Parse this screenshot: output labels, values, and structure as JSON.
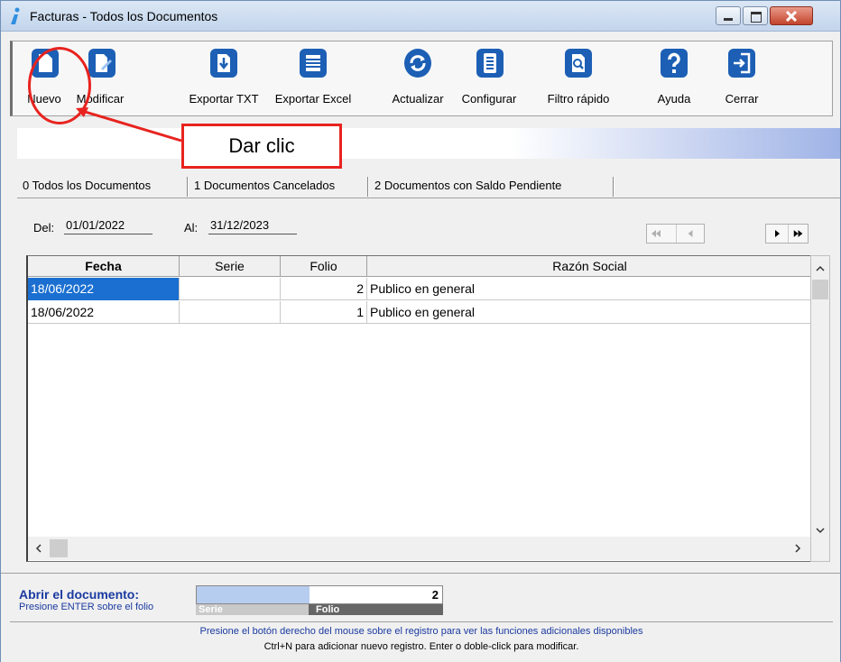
{
  "window": {
    "title": "Facturas - Todos los Documentos"
  },
  "toolbar": {
    "buttons": [
      {
        "label": "Nuevo",
        "icon": "new-document-icon"
      },
      {
        "label": "Modificar",
        "icon": "edit-document-icon"
      },
      {
        "label": "Exportar TXT",
        "icon": "export-txt-icon"
      },
      {
        "label": "Exportar Excel",
        "icon": "export-excel-icon"
      },
      {
        "label": "Actualizar",
        "icon": "refresh-icon"
      },
      {
        "label": "Configurar",
        "icon": "configure-icon"
      },
      {
        "label": "Filtro rápido",
        "icon": "quick-filter-icon"
      },
      {
        "label": "Ayuda",
        "icon": "help-icon"
      },
      {
        "label": "Cerrar",
        "icon": "close-door-icon"
      }
    ]
  },
  "callout": {
    "text": "Dar clic"
  },
  "tabs": [
    {
      "label": "0 Todos los Documentos"
    },
    {
      "label": "1 Documentos Cancelados"
    },
    {
      "label": "2 Documentos con Saldo Pendiente"
    }
  ],
  "filters": {
    "del_label": "Del:",
    "del_value": "01/01/2022",
    "al_label": "Al:",
    "al_value": "31/12/2023"
  },
  "grid": {
    "columns": [
      "Fecha",
      "Serie",
      "Folio",
      "Razón Social"
    ],
    "rows": [
      {
        "fecha": "18/06/2022",
        "serie": "",
        "folio": "2",
        "razon": "Publico en general"
      },
      {
        "fecha": "18/06/2022",
        "serie": "",
        "folio": "1",
        "razon": "Publico en general"
      }
    ]
  },
  "footer": {
    "abrir": "Abrir el documento:",
    "presione": "Presione ENTER sobre el folio",
    "serie_caption": "Serie",
    "folio_caption": "Folio",
    "folio_value": "2",
    "status_line1": "Presione el botón derecho del mouse sobre el registro para ver las funciones adicionales disponibles",
    "status_line2": "Ctrl+N para adicionar nuevo registro. Enter o doble-click para modificar."
  },
  "colors": {
    "accent": "#1c5fb5",
    "callout": "#e8231f",
    "selection": "#1a6fd1"
  }
}
